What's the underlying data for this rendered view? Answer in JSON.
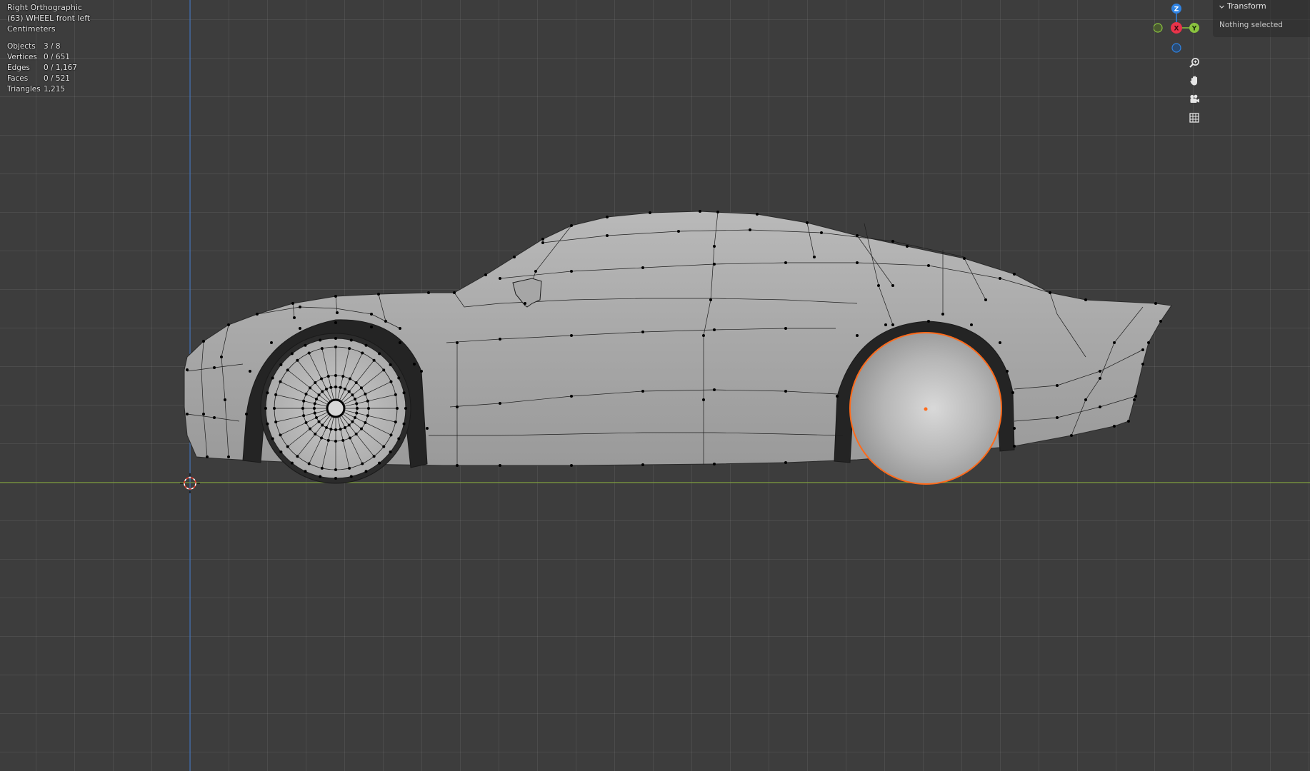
{
  "viewport": {
    "view_name": "Right Orthographic",
    "active_object": "(63) WHEEL front left",
    "units": "Centimeters"
  },
  "stats": [
    {
      "label": "Objects",
      "value": "3 / 8"
    },
    {
      "label": "Vertices",
      "value": "0 / 651"
    },
    {
      "label": "Edges",
      "value": "0 / 1,167"
    },
    {
      "label": "Faces",
      "value": "0 / 521"
    },
    {
      "label": "Triangles",
      "value": "1,215"
    }
  ],
  "gizmo": {
    "z_label": "Z",
    "x_label": "X",
    "y_label": "Y",
    "colors": {
      "x": "#e8334a",
      "y": "#8ac33f",
      "z": "#2f83e3"
    }
  },
  "nav_buttons": [
    {
      "name": "zoom-icon"
    },
    {
      "name": "pan-hand-icon"
    },
    {
      "name": "camera-icon"
    },
    {
      "name": "grid-view-icon"
    }
  ],
  "n_panel": {
    "header": "Transform",
    "body": "Nothing selected"
  },
  "colors": {
    "background": "#3d3d3d",
    "x_axis": "#7a9a3a",
    "z_axis": "#3e6fb4",
    "selection": "#ff6a1a",
    "vertex": "#000000"
  }
}
